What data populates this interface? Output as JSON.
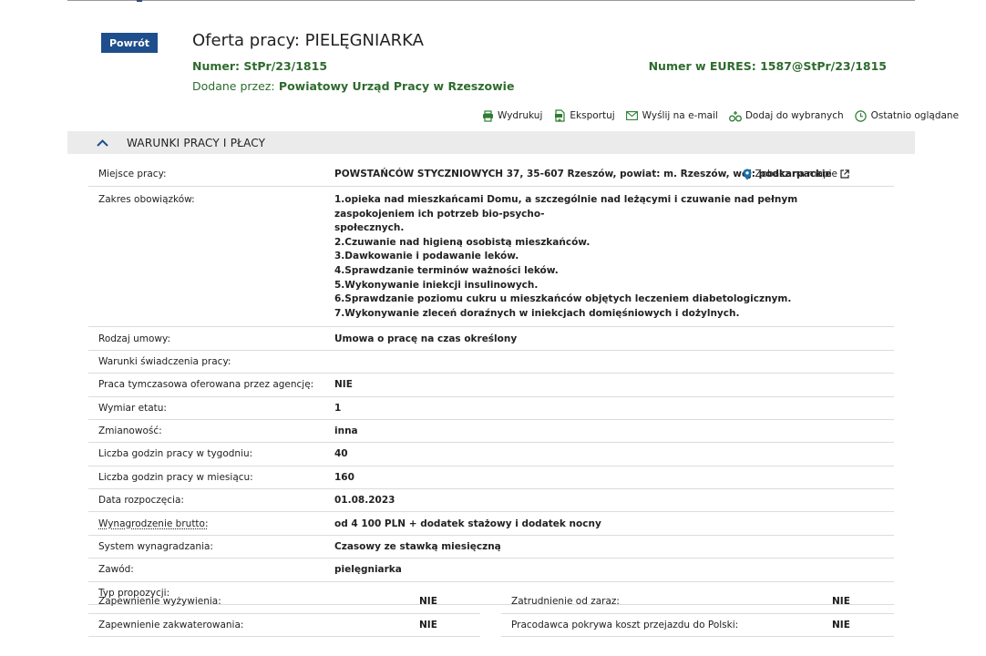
{
  "header": {
    "back_label": "Powrót",
    "title": "Oferta pracy: PIELĘGNIARKA",
    "number_label": "Numer:",
    "number_value": "StPr/23/1815",
    "eures_label": "Numer w EURES:",
    "eures_value": "1587@StPr/23/1815",
    "added_by_label": "Dodane przez:",
    "added_by_value": "Powiatowy Urząd Pracy w Rzeszowie"
  },
  "actions": [
    {
      "label": "Wydrukuj",
      "icon": "printer-icon"
    },
    {
      "label": "Eksportuj",
      "icon": "pdf-export-icon"
    },
    {
      "label": "Wyślij na e-mail",
      "icon": "envelope-icon"
    },
    {
      "label": "Dodaj do wybranych",
      "icon": "add-favorite-icon"
    },
    {
      "label": "Ostatnio oglądane",
      "icon": "clock-icon"
    }
  ],
  "section": {
    "title": "WARUNKI PRACY I PŁACY",
    "icon": "chevron-up-icon"
  },
  "place": {
    "label": "Miejsce pracy:",
    "value": "POWSTAŃCÓW STYCZNIOWYCH 37, 35-607 Rzeszów, powiat: m. Rzeszów, woj: podkarpackie",
    "map_link": "Zobacz na mapie"
  },
  "duties": {
    "label": "Zakres obowiązków:",
    "lines": [
      "1.opieka nad mieszkańcami Domu, a szczególnie nad leżącymi i czuwanie nad pełnym zaspokojeniem ich potrzeb bio-psycho-",
      "społecznych.",
      "2.Czuwanie nad higieną osobistą mieszkańców.",
      "3.Dawkowanie i podawanie leków.",
      "4.Sprawdzanie terminów ważności leków.",
      "5.Wykonywanie iniekcji insulinowych.",
      "6.Sprawdzanie poziomu cukru u mieszkańców objętych leczeniem diabetologicznym.",
      "7.Wykonywanie zleceń doraźnych w iniekcjach domięśniowych i dożylnych."
    ]
  },
  "rows": [
    {
      "label": "Rodzaj umowy:",
      "value": "Umowa o pracę na czas określony"
    },
    {
      "label": "Warunki świadczenia pracy:",
      "value": ""
    },
    {
      "label": "Praca tymczasowa oferowana przez agencję:",
      "value": "NIE"
    },
    {
      "label": "Wymiar etatu:",
      "value": "1"
    },
    {
      "label": "Zmianowość:",
      "value": "inna"
    },
    {
      "label": "Liczba godzin pracy w tygodniu:",
      "value": "40"
    },
    {
      "label": "Liczba godzin pracy w miesiącu:",
      "value": "160"
    },
    {
      "label": "Data rozpoczęcia:",
      "value": "01.08.2023"
    },
    {
      "label": "Wynagrodzenie brutto:",
      "value": "od 4 100 PLN + dodatek stażowy i dodatek nocny"
    },
    {
      "label": "System wynagradzania:",
      "value": "Czasowy ze stawką miesięczną"
    },
    {
      "label": "Zawód:",
      "value": "pielęgniarka"
    },
    {
      "label": "Typ propozycji:",
      "value": ""
    }
  ],
  "split_rows": [
    {
      "left_label": "Zapewnienie wyżywienia:",
      "left_value": "NIE",
      "right_label": "Zatrudnienie od zaraz:",
      "right_value": "NIE"
    },
    {
      "left_label": "Zapewnienie zakwaterowania:",
      "left_value": "NIE",
      "right_label": "Pracodawca pokrywa koszt przejazdu do Polski:",
      "right_value": "NIE"
    }
  ],
  "colors": {
    "accent_blue": "#1f4e8c",
    "meta_green": "#2e6b2e",
    "section_bg": "#ebebeb",
    "icon_green": "#2e7d32",
    "pin_blue": "#1a6fa8"
  }
}
